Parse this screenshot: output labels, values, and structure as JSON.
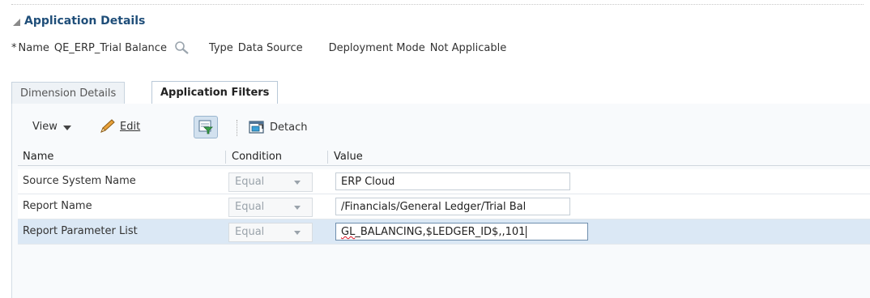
{
  "section": {
    "title": "Application Details"
  },
  "details": {
    "required_mark": "*",
    "name_label": "Name",
    "name_value": "QE_ERP_Trial Balance",
    "type_label": "Type",
    "type_value": "Data Source",
    "deployment_label": "Deployment Mode",
    "deployment_value": "Not Applicable"
  },
  "tabs": [
    {
      "label": "Dimension Details"
    },
    {
      "label": "Application Filters"
    }
  ],
  "toolbar": {
    "view_label": "View",
    "edit_label": "Edit",
    "detach_label": "Detach"
  },
  "table": {
    "columns": [
      "Name",
      "Condition",
      "Value"
    ],
    "rows": [
      {
        "name": "Source System Name",
        "condition": "Equal",
        "value": "ERP Cloud"
      },
      {
        "name": "Report Name",
        "condition": "Equal",
        "value": "/Financials/General Ledger/Trial Bal"
      },
      {
        "name": "Report Parameter List",
        "condition": "Equal",
        "value_prefix": "GL",
        "value_rest": "_BALANCING,$LEDGER_ID$,,101"
      }
    ]
  },
  "colors": {
    "accent": "#1f4e79",
    "selected_row": "#dbe8f5",
    "spell_error": "#dd1122"
  }
}
